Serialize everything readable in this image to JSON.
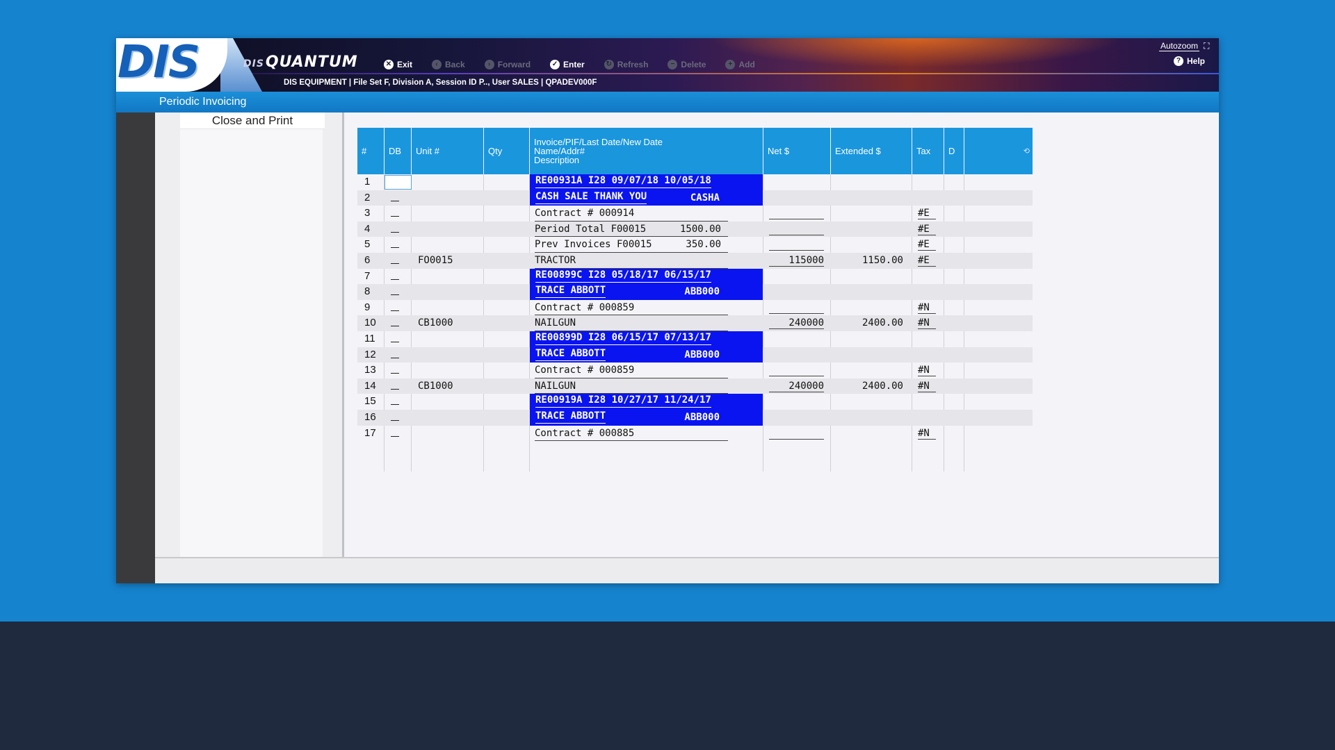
{
  "app": {
    "logo": "DIS",
    "brand_prefix": "DIS",
    "brand_name": "QUANTUM",
    "session": "DIS EQUIPMENT | File Set F, Division A, Session ID P.., User SALES | QPADEV000F",
    "screen_title": "Periodic Invoicing",
    "autozoom_label": "Autozoom"
  },
  "toolbar": [
    {
      "label": "Exit",
      "icon": "x-circle-icon",
      "glyph": "✕",
      "enabled": true
    },
    {
      "label": "Back",
      "icon": "back-icon",
      "glyph": "‹",
      "enabled": false
    },
    {
      "label": "Forward",
      "icon": "forward-icon",
      "glyph": "›",
      "enabled": false
    },
    {
      "label": "Enter",
      "icon": "check-icon",
      "glyph": "✓",
      "enabled": true
    },
    {
      "label": "Refresh",
      "icon": "refresh-icon",
      "glyph": "↻",
      "enabled": false
    },
    {
      "label": "Delete",
      "icon": "delete-icon",
      "glyph": "−",
      "enabled": false
    },
    {
      "label": "Add",
      "icon": "add-icon",
      "glyph": "+",
      "enabled": false
    }
  ],
  "help_label": "Help",
  "menu": {
    "items": [
      "Close and Print"
    ]
  },
  "grid": {
    "headers": {
      "num": "#",
      "db": "DB",
      "unit": "Unit #",
      "qty": "Qty",
      "desc_line1": "Invoice/PIF/Last Date/New Date",
      "desc_line2": "Name/Addr#",
      "desc_line3": "Description",
      "net": "Net $",
      "extended": "Extended $",
      "tax": "Tax",
      "d": "D"
    },
    "rows": [
      {
        "n": "1",
        "unit": "",
        "desc_l": "RE00931A I28 09/07/18 10/05/18",
        "desc_r": "",
        "hi": true,
        "net": "",
        "ext": "",
        "tax": "",
        "db_box": true
      },
      {
        "n": "2",
        "unit": "",
        "desc_l": "CASH SALE THANK YOU",
        "desc_r": "CASHA",
        "hi": true,
        "net": "",
        "ext": "",
        "tax": ""
      },
      {
        "n": "3",
        "unit": "",
        "desc_l": "Contract # 000914",
        "desc_r": "",
        "hi": false,
        "net": "",
        "ext": "",
        "tax": "#E",
        "net_line": true
      },
      {
        "n": "4",
        "unit": "",
        "desc_l": "Period Total F00015",
        "desc_r": "1500.00",
        "hi": false,
        "net": "",
        "ext": "",
        "tax": "#E",
        "net_line": true
      },
      {
        "n": "5",
        "unit": "",
        "desc_l": "Prev Invoices F00015",
        "desc_r": "350.00",
        "hi": false,
        "net": "",
        "ext": "",
        "tax": "#E",
        "net_line": true
      },
      {
        "n": "6",
        "unit": "FO0015",
        "desc_l": "TRACTOR",
        "desc_r": "",
        "hi": false,
        "net": "115000",
        "ext": "1150.00",
        "tax": "#E",
        "net_line": true
      },
      {
        "n": "7",
        "unit": "",
        "desc_l": "RE00899C I28 05/18/17 06/15/17",
        "desc_r": "",
        "hi": true,
        "net": "",
        "ext": "",
        "tax": ""
      },
      {
        "n": "8",
        "unit": "",
        "desc_l": "TRACE ABBOTT",
        "desc_r": "ABB000",
        "hi": true,
        "net": "",
        "ext": "",
        "tax": ""
      },
      {
        "n": "9",
        "unit": "",
        "desc_l": "Contract # 000859",
        "desc_r": "",
        "hi": false,
        "net": "",
        "ext": "",
        "tax": "#N",
        "net_line": true
      },
      {
        "n": "10",
        "unit": "CB1000",
        "desc_l": "NAILGUN",
        "desc_r": "",
        "hi": false,
        "net": "240000",
        "ext": "2400.00",
        "tax": "#N",
        "net_line": true
      },
      {
        "n": "11",
        "unit": "",
        "desc_l": "RE00899D I28 06/15/17 07/13/17",
        "desc_r": "",
        "hi": true,
        "net": "",
        "ext": "",
        "tax": ""
      },
      {
        "n": "12",
        "unit": "",
        "desc_l": "TRACE ABBOTT",
        "desc_r": "ABB000",
        "hi": true,
        "net": "",
        "ext": "",
        "tax": ""
      },
      {
        "n": "13",
        "unit": "",
        "desc_l": "Contract # 000859",
        "desc_r": "",
        "hi": false,
        "net": "",
        "ext": "",
        "tax": "#N",
        "net_line": true
      },
      {
        "n": "14",
        "unit": "CB1000",
        "desc_l": "NAILGUN",
        "desc_r": "",
        "hi": false,
        "net": "240000",
        "ext": "2400.00",
        "tax": "#N",
        "net_line": true
      },
      {
        "n": "15",
        "unit": "",
        "desc_l": "RE00919A I28 10/27/17 11/24/17",
        "desc_r": "",
        "hi": true,
        "net": "",
        "ext": "",
        "tax": ""
      },
      {
        "n": "16",
        "unit": "",
        "desc_l": "TRACE ABBOTT",
        "desc_r": "ABB000",
        "hi": true,
        "net": "",
        "ext": "",
        "tax": ""
      },
      {
        "n": "17",
        "unit": "",
        "desc_l": "Contract # 000885",
        "desc_r": "",
        "hi": false,
        "net": "",
        "ext": "",
        "tax": "#N",
        "net_line": true
      }
    ]
  },
  "colors": {
    "page_bg": "#1683cf",
    "header_blue": "#1a96dd",
    "highlight_blue": "#0a14f0"
  }
}
